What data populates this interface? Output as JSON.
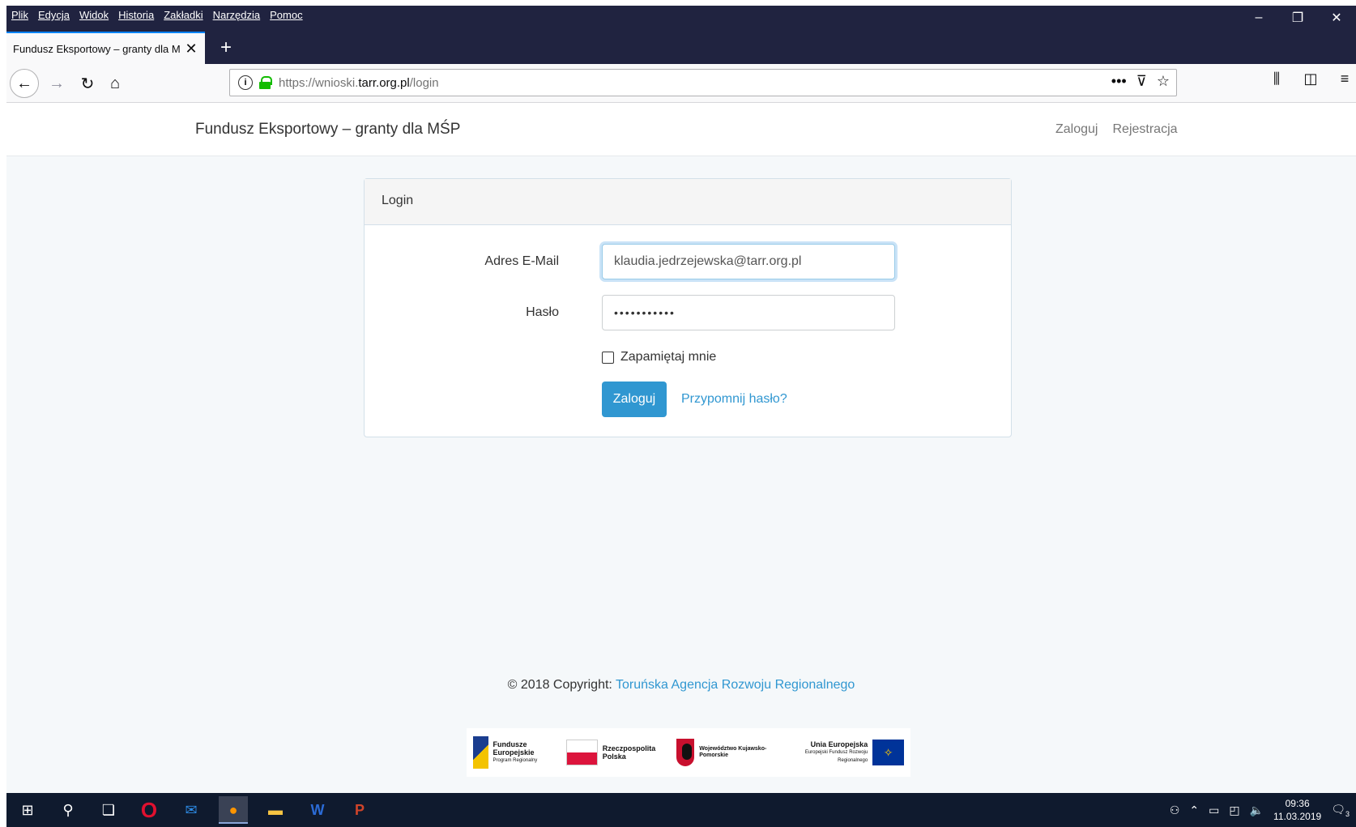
{
  "browser": {
    "menu": [
      "Plik",
      "Edycja",
      "Widok",
      "Historia",
      "Zakładki",
      "Narzędzia",
      "Pomoc"
    ],
    "tab_title": "Fundusz Eksportowy – granty dla M",
    "url_prefix": "https://wnioski.",
    "url_domain": "tarr.org.pl",
    "url_path": "/login"
  },
  "site": {
    "brand": "Fundusz Eksportowy – granty dla MŚP",
    "nav_login": "Zaloguj",
    "nav_register": "Rejestracja"
  },
  "login_card": {
    "header": "Login",
    "email_label": "Adres E-Mail",
    "email_value": "klaudia.jedrzejewska@tarr.org.pl",
    "password_label": "Hasło",
    "password_mask": "•••••••••••",
    "remember_label": "Zapamiętaj mnie",
    "remember_checked": false,
    "submit_label": "Zaloguj",
    "forgot_label": "Przypomnij hasło?"
  },
  "footer": {
    "copyright": "© 2018 Copyright: ",
    "org": "Toruńska Agencja Rozwoju Regionalnego",
    "logos": {
      "fe_title": "Fundusze Europejskie",
      "fe_sub": "Program Regionalny",
      "pl": "Rzeczpospolita Polska",
      "woj": "Województwo Kujawsko-Pomorskie",
      "eu_title": "Unia Europejska",
      "eu_sub": "Europejski Fundusz Rozwoju Regionalnego"
    }
  },
  "taskbar": {
    "time": "09:36",
    "date": "11.03.2019",
    "notifications": "3"
  },
  "colors": {
    "chrome_dark": "#202340",
    "accent": "#3097d1",
    "page_bg": "#f5f8fa"
  }
}
